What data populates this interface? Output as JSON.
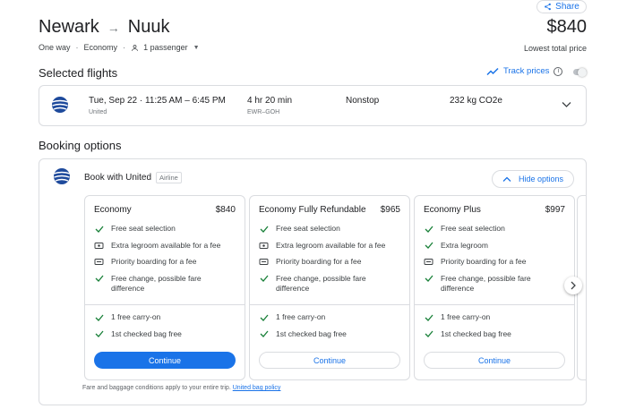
{
  "header": {
    "share_label": "Share",
    "origin": "Newark",
    "destination": "Nuuk",
    "trip_type": "One way",
    "cabin": "Economy",
    "passengers": "1 passenger",
    "price": "$840",
    "price_note": "Lowest total price"
  },
  "selected_flights": {
    "title": "Selected flights",
    "track_label": "Track prices",
    "flight": {
      "date_time": "Tue, Sep 22 · 11:25 AM – 6:45 PM",
      "airline": "United",
      "duration": "4 hr 20 min",
      "airports": "EWR–GOH",
      "stops": "Nonstop",
      "emissions": "232 kg CO2e"
    }
  },
  "booking": {
    "title": "Booking options",
    "provider": "Book with United",
    "provider_badge": "Airline",
    "hide_label": "Hide options",
    "fares": [
      {
        "name": "Economy",
        "price": "$840",
        "features": [
          {
            "icon": "check-icon",
            "text": "Free seat selection"
          },
          {
            "icon": "seat-fee-icon",
            "text": "Extra legroom available for a fee"
          },
          {
            "icon": "boarding-fee-icon",
            "text": "Priority boarding for a fee"
          },
          {
            "icon": "check-icon",
            "text": "Free change, possible fare difference"
          }
        ],
        "bags": [
          "1 free carry-on",
          "1st checked bag free"
        ],
        "continue_label": "Continue",
        "primary": true
      },
      {
        "name": "Economy Fully Refundable",
        "price": "$965",
        "features": [
          {
            "icon": "check-icon",
            "text": "Free seat selection"
          },
          {
            "icon": "seat-fee-icon",
            "text": "Extra legroom available for a fee"
          },
          {
            "icon": "boarding-fee-icon",
            "text": "Priority boarding for a fee"
          },
          {
            "icon": "check-icon",
            "text": "Free change, possible fare difference"
          }
        ],
        "bags": [
          "1 free carry-on",
          "1st checked bag free"
        ],
        "continue_label": "Continue",
        "primary": false
      },
      {
        "name": "Economy Plus",
        "price": "$997",
        "features": [
          {
            "icon": "check-icon",
            "text": "Free seat selection"
          },
          {
            "icon": "check-icon",
            "text": "Extra legroom"
          },
          {
            "icon": "boarding-fee-icon",
            "text": "Priority boarding for a fee"
          },
          {
            "icon": "check-icon",
            "text": "Free change, possible fare difference"
          }
        ],
        "bags": [
          "1 free carry-on",
          "1st checked bag free"
        ],
        "continue_label": "Continue",
        "primary": false
      }
    ],
    "footnote": "Fare and baggage conditions apply to your entire trip.",
    "footnote_link": "United bag policy"
  },
  "colors": {
    "accent": "#1a73e8",
    "check": "#188038",
    "border": "#dadce0"
  }
}
